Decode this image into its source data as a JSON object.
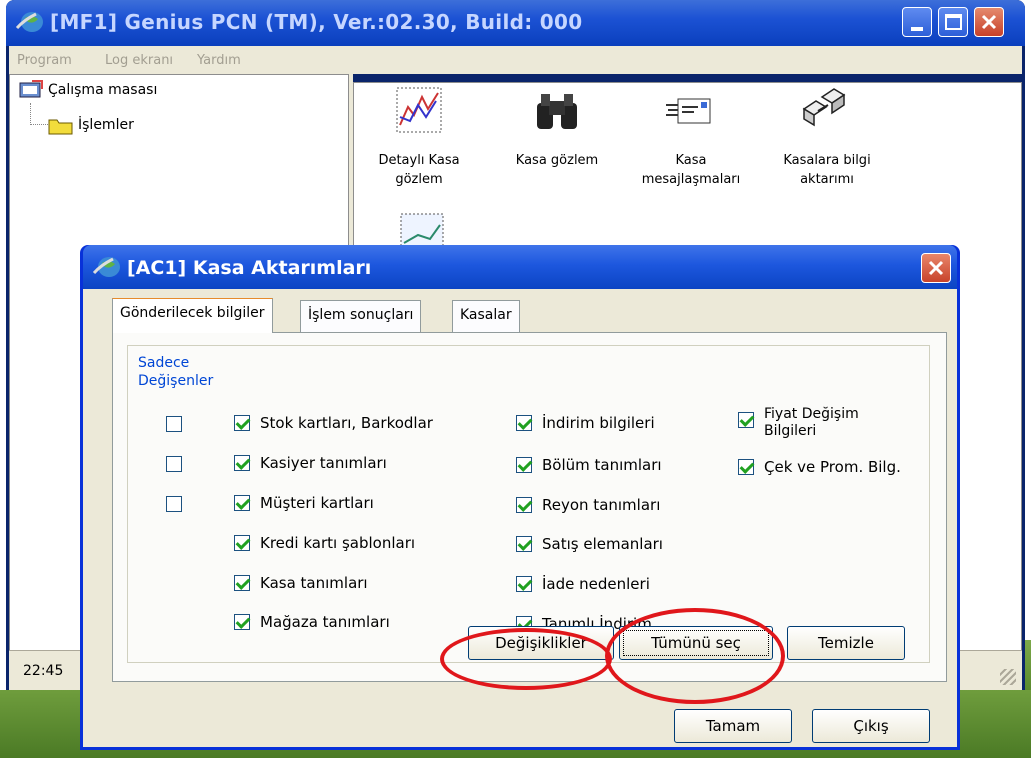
{
  "main_window": {
    "title": "[MF1] Genius PCN (TM), Ver.:02.30, Build: 000",
    "menu": [
      "Program",
      "Log ekranı",
      "Yardım"
    ],
    "tree": {
      "root": "Çalışma masası",
      "child": "İşlemler"
    },
    "icons": [
      {
        "label": "Detaylı Kasa gözlem",
        "icon": "chart-icon"
      },
      {
        "label": "Kasa gözlem",
        "icon": "binoculars-icon"
      },
      {
        "label": "Kasa mesajlaşmaları",
        "icon": "message-icon"
      },
      {
        "label": "Kasalara bilgi aktarımı",
        "icon": "transfer-icon"
      }
    ],
    "status_time": "22:45"
  },
  "dialog": {
    "title": "[AC1] Kasa Aktarımları",
    "tabs": [
      "Gönderilecek bilgiler",
      "İşlem sonuçları",
      "Kasalar"
    ],
    "group_label": "Sadece Değişenler",
    "col1": [
      {
        "label": "Stok kartları, Barkodlar",
        "checked": true
      },
      {
        "label": "Kasiyer tanımları",
        "checked": true
      },
      {
        "label": "Müşteri kartları",
        "checked": true
      },
      {
        "label": "Kredi kartı şablonları",
        "checked": true
      },
      {
        "label": "Kasa tanımları",
        "checked": true
      },
      {
        "label": "Mağaza tanımları",
        "checked": true
      }
    ],
    "col2": [
      {
        "label": "İndirim bilgileri",
        "checked": true
      },
      {
        "label": "Bölüm tanımları",
        "checked": true
      },
      {
        "label": "Reyon tanımları",
        "checked": true
      },
      {
        "label": "Satış elemanları",
        "checked": true
      },
      {
        "label": "İade nedenleri",
        "checked": true
      },
      {
        "label": "Tanımlı İndirim",
        "checked": true
      }
    ],
    "col3": [
      {
        "label": "Fiyat Değişim Bilgileri",
        "checked": true
      },
      {
        "label": "Çek ve Prom. Bilg.",
        "checked": true
      }
    ],
    "buttons": {
      "changes": "Değişiklikler",
      "select_all": "Tümünü seç",
      "clear": "Temizle",
      "ok": "Tamam",
      "exit": "Çıkış"
    }
  },
  "colors": {
    "title_blue": "#1c52d4",
    "annotation_red": "#e0171b",
    "check_green": "#21a121"
  }
}
